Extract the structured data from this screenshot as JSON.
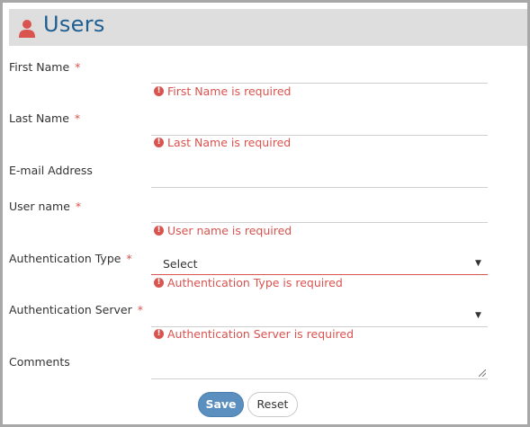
{
  "header": {
    "title": "Users",
    "icon": "user-icon",
    "title_color": "#1e5f92",
    "background": "#dedede"
  },
  "form": {
    "first_name": {
      "label": "First Name",
      "required_mark": "*",
      "value": "",
      "error": "First Name is required"
    },
    "last_name": {
      "label": "Last Name",
      "required_mark": "*",
      "value": "",
      "error": "Last Name is required"
    },
    "email": {
      "label": "E-mail Address",
      "value": ""
    },
    "user_name": {
      "label": "User name",
      "required_mark": "*",
      "value": "",
      "error": "User name is required"
    },
    "auth_type": {
      "label": "Authentication Type",
      "required_mark": "*",
      "selected": "Select",
      "error": "Authentication Type is required"
    },
    "auth_server": {
      "label": "Authentication Server",
      "required_mark": "*",
      "selected": "",
      "error": "Authentication Server is required"
    },
    "comments": {
      "label": "Comments",
      "value": ""
    }
  },
  "buttons": {
    "save": "Save",
    "reset": "Reset"
  },
  "colors": {
    "error": "#d9534f",
    "save_button": "#5b8fbf"
  }
}
